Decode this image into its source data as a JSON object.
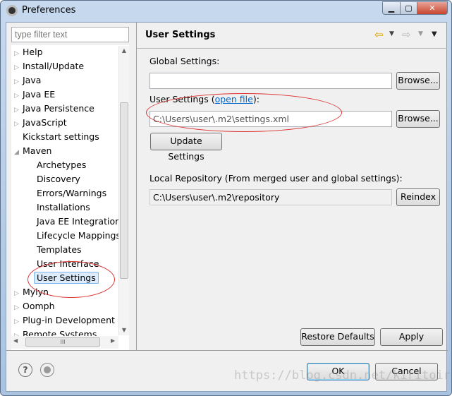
{
  "window": {
    "title": "Preferences"
  },
  "filter": {
    "placeholder": "type filter text"
  },
  "tree": [
    {
      "label": "Help",
      "level": 0,
      "expander": "collapsed"
    },
    {
      "label": "Install/Update",
      "level": 0,
      "expander": "collapsed"
    },
    {
      "label": "Java",
      "level": 0,
      "expander": "collapsed"
    },
    {
      "label": "Java EE",
      "level": 0,
      "expander": "collapsed"
    },
    {
      "label": "Java Persistence",
      "level": 0,
      "expander": "collapsed"
    },
    {
      "label": "JavaScript",
      "level": 0,
      "expander": "collapsed"
    },
    {
      "label": "Kickstart settings",
      "level": 0,
      "expander": "none"
    },
    {
      "label": "Maven",
      "level": 0,
      "expander": "expanded"
    },
    {
      "label": "Archetypes",
      "level": 1
    },
    {
      "label": "Discovery",
      "level": 1
    },
    {
      "label": "Errors/Warnings",
      "level": 1
    },
    {
      "label": "Installations",
      "level": 1
    },
    {
      "label": "Java EE Integration",
      "level": 1
    },
    {
      "label": "Lifecycle Mappings",
      "level": 1
    },
    {
      "label": "Templates",
      "level": 1
    },
    {
      "label": "User Interface",
      "level": 1
    },
    {
      "label": "User Settings",
      "level": 1,
      "selected": true
    },
    {
      "label": "Mylyn",
      "level": 0,
      "expander": "collapsed"
    },
    {
      "label": "Oomph",
      "level": 0,
      "expander": "collapsed"
    },
    {
      "label": "Plug-in Development",
      "level": 0,
      "expander": "collapsed"
    },
    {
      "label": "Remote Systems",
      "level": 0,
      "expander": "collapsed"
    }
  ],
  "page": {
    "title": "User Settings",
    "global_label": "Global Settings:",
    "global_value": "",
    "browse": "Browse...",
    "user_label_prefix": "User Settings (",
    "open_file": "open file",
    "user_label_suffix": "):",
    "user_value": "C:\\Users\\user\\.m2\\settings.xml",
    "update": "Update Settings",
    "local_label": "Local Repository (From merged user and global settings):",
    "local_value": "C:\\Users\\user\\.m2\\repository",
    "reindex": "Reindex",
    "restore": "Restore Defaults",
    "apply": "Apply"
  },
  "footer": {
    "ok": "OK",
    "cancel": "Cancel"
  },
  "watermark": "https://blog.csdn.net/kiritoir",
  "colors": {
    "link": "#0066cc",
    "annotation": "#dd3333",
    "selection": "#dcecfc"
  }
}
